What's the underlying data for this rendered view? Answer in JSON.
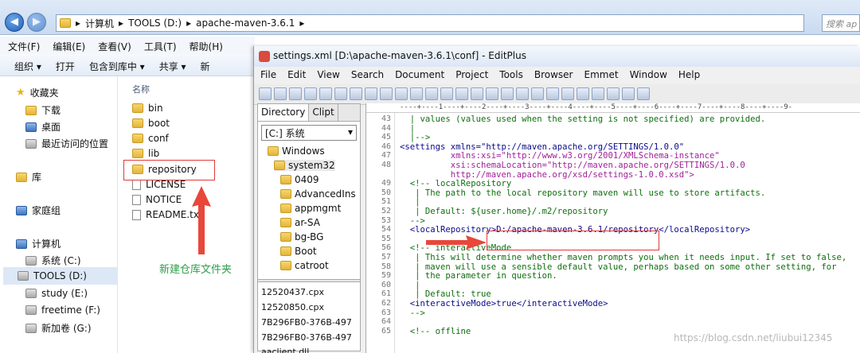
{
  "explorer": {
    "address_parts": [
      "计算机",
      "TOOLS (D:)",
      "apache-maven-3.6.1"
    ],
    "search_placeholder": "搜索 ap",
    "menu": [
      "文件(F)",
      "编辑(E)",
      "查看(V)",
      "工具(T)",
      "帮助(H)"
    ],
    "commands": [
      "组织 ▾",
      "打开",
      "包含到库中 ▾",
      "共享 ▾",
      "新"
    ],
    "nav": {
      "favorites": "收藏夹",
      "downloads": "下载",
      "desktop": "桌面",
      "recent": "最近访问的位置",
      "libraries": "库",
      "homegroup": "家庭组",
      "computer": "计算机",
      "drives": [
        "系统 (C:)",
        "TOOLS (D:)",
        "study (E:)",
        "freetime (F:)",
        "新加卷 (G:)"
      ]
    },
    "column_name": "名称",
    "folders": [
      "bin",
      "boot",
      "conf",
      "lib",
      "repository"
    ],
    "files": [
      "LICENSE",
      "NOTICE",
      "README.txt"
    ],
    "annotation": "新建仓库文件夹"
  },
  "editplus": {
    "title": "settings.xml [D:\\apache-maven-3.6.1\\conf] - EditPlus",
    "menu": [
      "File",
      "Edit",
      "View",
      "Search",
      "Document",
      "Project",
      "Tools",
      "Browser",
      "Emmet",
      "Window",
      "Help"
    ],
    "dir_tabs": [
      "Directory",
      "Clipt"
    ],
    "drive": "[C:] 系统",
    "dirs": [
      "Windows",
      "system32",
      "0409",
      "AdvancedIns",
      "appmgmt",
      "ar-SA",
      "bg-BG",
      "Boot",
      "catroot"
    ],
    "file_list": [
      "12520437.cpx",
      "12520850.cpx",
      "7B296FB0-376B-497",
      "7B296FB0-376B-497",
      "aaclient.dll"
    ],
    "ruler": "----+----1----+----2----+----3----+----4----+----5----+----6----+----7----+----8----+----9-",
    "lines": [
      {
        "n": "43",
        "t": "  | values (values used when the setting is not specified) are provided."
      },
      {
        "n": "44",
        "t": "  |"
      },
      {
        "n": "45",
        "t": "  |-->"
      },
      {
        "n": "46",
        "t": "<settings xmlns=\"http://maven.apache.org/SETTINGS/1.0.0\""
      },
      {
        "n": "47",
        "t": "          xmlns:xsi=\"http://www.w3.org/2001/XMLSchema-instance\""
      },
      {
        "n": "48",
        "t": "          xsi:schemaLocation=\"http://maven.apache.org/SETTINGS/1.0.0"
      },
      {
        "n": "",
        "t": "          http://maven.apache.org/xsd/settings-1.0.0.xsd\">"
      },
      {
        "n": "49",
        "t": "  <!-- localRepository"
      },
      {
        "n": "50",
        "t": "   | The path to the local repository maven will use to store artifacts."
      },
      {
        "n": "51",
        "t": "   |"
      },
      {
        "n": "52",
        "t": "   | Default: ${user.home}/.m2/repository"
      },
      {
        "n": "53",
        "t": "  -->"
      },
      {
        "n": "54",
        "t": "  <localRepository>D:/apache-maven-3.6.1/repository</localRepository>"
      },
      {
        "n": "55",
        "t": ""
      },
      {
        "n": "56",
        "t": "  <!-- interactiveMode"
      },
      {
        "n": "57",
        "t": "   | This will determine whether maven prompts you when it needs input. If set to false,"
      },
      {
        "n": "58",
        "t": "   | maven will use a sensible default value, perhaps based on some other setting, for"
      },
      {
        "n": "59",
        "t": "   | the parameter in question."
      },
      {
        "n": "60",
        "t": "   |"
      },
      {
        "n": "61",
        "t": "   | Default: true"
      },
      {
        "n": "62",
        "t": "  <interactiveMode>true</interactiveMode>"
      },
      {
        "n": "63",
        "t": "  -->"
      },
      {
        "n": "64",
        "t": ""
      },
      {
        "n": "65",
        "t": "  <!-- offline"
      }
    ]
  },
  "watermark": "https://blog.csdn.net/liubui12345"
}
